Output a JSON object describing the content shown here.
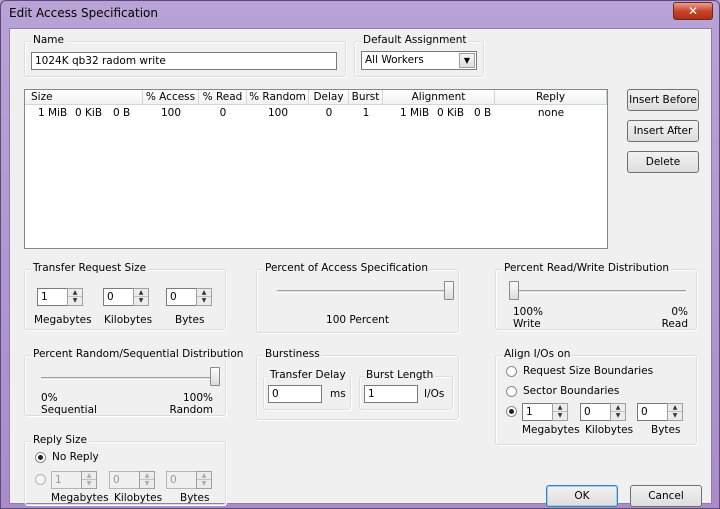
{
  "window": {
    "title": "Edit Access Specification",
    "close_glyph": "✕"
  },
  "name_group": {
    "legend": "Name",
    "value": "1024K qb32 radom write"
  },
  "default_assignment": {
    "legend": "Default Assignment",
    "selected": "All Workers"
  },
  "spec_list": {
    "columns": [
      "Size",
      "% Access",
      "% Read",
      "% Random",
      "Delay",
      "Burst",
      "Alignment",
      "Reply"
    ],
    "rows": [
      {
        "size_mib": "1 MiB",
        "size_kib": "0 KiB",
        "size_b": "0 B",
        "access": "100",
        "read": "0",
        "random": "100",
        "delay": "0",
        "burst": "1",
        "align_mib": "1 MiB",
        "align_kib": "0 KiB",
        "align_b": "0 B",
        "reply": "none"
      }
    ]
  },
  "side_buttons": {
    "insert_before": "Insert Before",
    "insert_after": "Insert After",
    "delete": "Delete"
  },
  "transfer_size": {
    "legend": "Transfer Request Size",
    "megabytes_value": "1",
    "kilobytes_value": "0",
    "bytes_value": "0",
    "megabytes_label": "Megabytes",
    "kilobytes_label": "Kilobytes",
    "bytes_label": "Bytes"
  },
  "percent_access": {
    "legend": "Percent of Access Specification",
    "value_label": "100 Percent",
    "value": 100
  },
  "read_write": {
    "legend": "Percent Read/Write Distribution",
    "left_pct": "100%",
    "left_label": "Write",
    "right_pct": "0%",
    "right_label": "Read",
    "read_percent": 0
  },
  "random_seq": {
    "legend": "Percent Random/Sequential Distribution",
    "left_pct": "0%",
    "left_label": "Sequential",
    "right_pct": "100%",
    "right_label": "Random",
    "random_percent": 100
  },
  "burstiness": {
    "legend": "Burstiness",
    "delay_legend": "Transfer Delay",
    "delay_value": "0",
    "delay_unit": "ms",
    "burst_legend": "Burst Length",
    "burst_value": "1",
    "burst_unit": "I/Os"
  },
  "align_ios": {
    "legend": "Align I/Os on",
    "opt_request": "Request Size Boundaries",
    "opt_sector": "Sector Boundaries",
    "megabytes_value": "1",
    "kilobytes_value": "0",
    "bytes_value": "0",
    "megabytes_label": "Megabytes",
    "kilobytes_label": "Kilobytes",
    "bytes_label": "Bytes",
    "selected": "custom"
  },
  "reply_size": {
    "legend": "Reply Size",
    "opt_no_reply": "No Reply",
    "megabytes_value": "1",
    "kilobytes_value": "0",
    "bytes_value": "0",
    "megabytes_label": "Megabytes",
    "kilobytes_label": "Kilobytes",
    "bytes_label": "Bytes",
    "selected": "no_reply"
  },
  "dialog_buttons": {
    "ok": "OK",
    "cancel": "Cancel"
  },
  "spin_glyphs": {
    "up": "▲",
    "down": "▼"
  },
  "combo_glyph": "▼"
}
